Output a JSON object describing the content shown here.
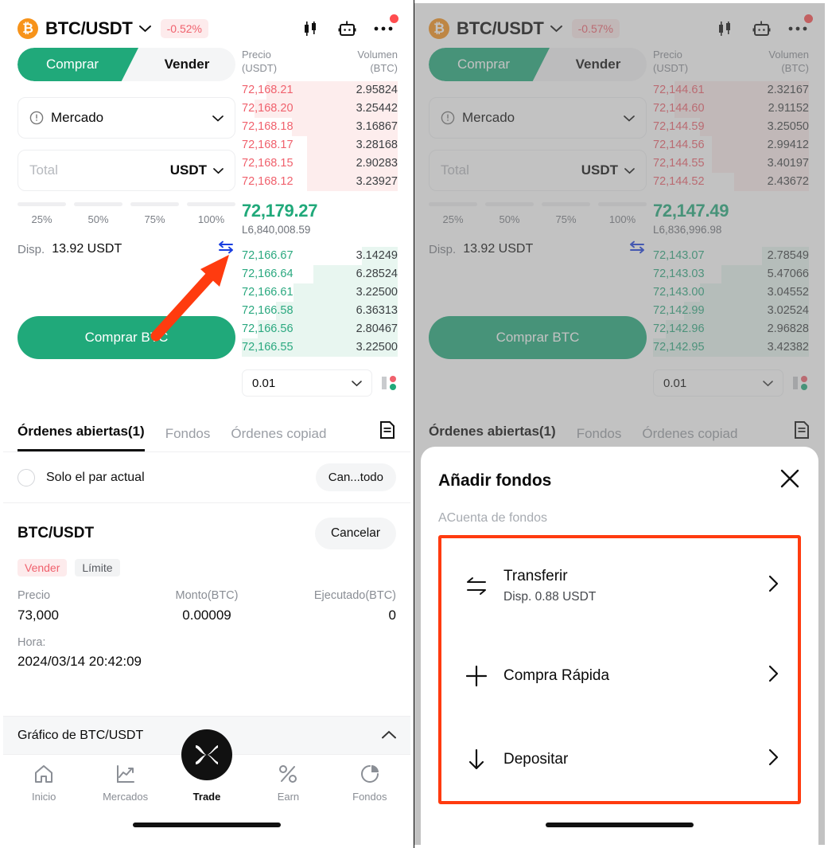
{
  "left": {
    "header": {
      "coin_symbol": "₿",
      "pair": "BTC/USDT",
      "change_pct": "-0.52%",
      "icons": [
        "candlestick-icon",
        "bot-icon",
        "more-icon"
      ]
    },
    "segment": {
      "buy": "Comprar",
      "sell": "Vender"
    },
    "order_type": {
      "label": "Mercado"
    },
    "total_field": {
      "placeholder": "Total",
      "currency": "USDT"
    },
    "percents": [
      "25%",
      "50%",
      "75%",
      "100%"
    ],
    "available": {
      "label": "Disp.",
      "value": "13.92 USDT"
    },
    "submit": "Comprar BTC",
    "orderbook": {
      "col_price": "Precio",
      "col_price_unit": "(USDT)",
      "col_volume": "Volumen",
      "col_volume_unit": "(BTC)",
      "asks": [
        {
          "price": "72,168.21",
          "volume": "2.95824",
          "depth": 84
        },
        {
          "price": "72,168.20",
          "volume": "3.25442",
          "depth": 92
        },
        {
          "price": "72,168.18",
          "volume": "3.16867",
          "depth": 68
        },
        {
          "price": "72,168.17",
          "volume": "3.28168",
          "depth": 58
        },
        {
          "price": "72,168.15",
          "volume": "2.90283",
          "depth": 58
        },
        {
          "price": "72,168.12",
          "volume": "3.23927",
          "depth": 58
        }
      ],
      "last_price": "72,179.27",
      "last_sub": "L6,840,008.59",
      "bids": [
        {
          "price": "72,166.67",
          "volume": "3.14249",
          "depth": 23
        },
        {
          "price": "72,166.64",
          "volume": "6.28524",
          "depth": 54
        },
        {
          "price": "72,166.61",
          "volume": "3.22500",
          "depth": 67
        },
        {
          "price": "72,166.58",
          "volume": "6.36313",
          "depth": 78
        },
        {
          "price": "72,166.56",
          "volume": "2.80467",
          "depth": 90
        },
        {
          "price": "72,166.55",
          "volume": "3.22500",
          "depth": 100
        }
      ],
      "tick_size": "0.01"
    },
    "tabs": [
      {
        "label": "Órdenes abiertas(1)",
        "active": true
      },
      {
        "label": "Fondos",
        "active": false
      },
      {
        "label": "Órdenes copiadas",
        "active": false
      }
    ],
    "filter": {
      "label": "Solo el par actual",
      "cancel_all": "Can...todo"
    },
    "order": {
      "pair": "BTC/USDT",
      "cancel": "Cancelar",
      "side": "Vender",
      "type": "Límite",
      "k_price": "Precio",
      "v_price": "73,000",
      "k_amount": "Monto(BTC)",
      "v_amount": "0.00009",
      "k_filled": "Ejecutado(BTC)",
      "v_filled": "0",
      "k_time": "Hora:",
      "v_time": "2024/03/14 20:42:09"
    },
    "chart_strip": {
      "label": "Gráfico de BTC/USDT"
    },
    "bottom_nav": [
      {
        "label": "Inicio",
        "icon": "home-icon",
        "active": false
      },
      {
        "label": "Mercados",
        "icon": "trending-up-icon",
        "active": false
      },
      {
        "label": "Trade",
        "icon": "trade-icon",
        "active": true
      },
      {
        "label": "Earn",
        "icon": "percent-icon",
        "active": false
      },
      {
        "label": "Fondos",
        "icon": "pie-chart-icon",
        "active": false
      }
    ]
  },
  "right": {
    "header": {
      "coin_symbol": "₿",
      "pair": "BTC/USDT",
      "change_pct": "-0.57%"
    },
    "segment": {
      "buy": "Comprar",
      "sell": "Vender"
    },
    "order_type": {
      "label": "Mercado"
    },
    "total_field": {
      "placeholder": "Total",
      "currency": "USDT"
    },
    "percents": [
      "25%",
      "50%",
      "75%",
      "100%"
    ],
    "available": {
      "label": "Disp.",
      "value": "13.92 USDT"
    },
    "submit": "Comprar BTC",
    "orderbook": {
      "col_price": "Precio",
      "col_price_unit": "(USDT)",
      "col_volume": "Volumen",
      "col_volume_unit": "(BTC)",
      "asks": [
        {
          "price": "72,144.61",
          "volume": "2.32167",
          "depth": 86
        },
        {
          "price": "72,144.60",
          "volume": "2.91152",
          "depth": 86
        },
        {
          "price": "72,144.59",
          "volume": "3.25050",
          "depth": 70
        },
        {
          "price": "72,144.56",
          "volume": "2.99412",
          "depth": 62
        },
        {
          "price": "72,144.55",
          "volume": "3.40197",
          "depth": 62
        },
        {
          "price": "72,144.52",
          "volume": "2.43672",
          "depth": 48
        }
      ],
      "last_price": "72,147.49",
      "last_sub": "L6,836,996.98",
      "bids": [
        {
          "price": "72,143.07",
          "volume": "2.78549",
          "depth": 30
        },
        {
          "price": "72,143.03",
          "volume": "5.47066",
          "depth": 56
        },
        {
          "price": "72,143.00",
          "volume": "3.04552",
          "depth": 70
        },
        {
          "price": "72,142.99",
          "volume": "3.02524",
          "depth": 80
        },
        {
          "price": "72,142.96",
          "volume": "2.96828",
          "depth": 92
        },
        {
          "price": "72,142.95",
          "volume": "3.42382",
          "depth": 100
        }
      ],
      "tick_size": "0.01"
    },
    "tabs": [
      {
        "label": "Órdenes abiertas(1)",
        "active": true
      },
      {
        "label": "Fondos",
        "active": false
      },
      {
        "label": "Órdenes copiad",
        "active": false
      }
    ],
    "sheet": {
      "title": "Añadir fondos",
      "subtitle": "ACuenta de fondos",
      "items": [
        {
          "icon": "transfer-icon",
          "title": "Transferir",
          "sub": "Disp.  0.88 USDT",
          "arrow": "›"
        },
        {
          "icon": "plus-icon",
          "title": "Compra Rápida",
          "sub": "",
          "arrow": "›"
        },
        {
          "icon": "arrow-down-icon",
          "title": "Depositar",
          "sub": "",
          "arrow": "›"
        }
      ]
    }
  },
  "colors": {
    "green": "#20A97A",
    "red": "#F0616D",
    "accent_orange": "#FF3B0F",
    "annotation_blue": "#1A3FE0"
  }
}
